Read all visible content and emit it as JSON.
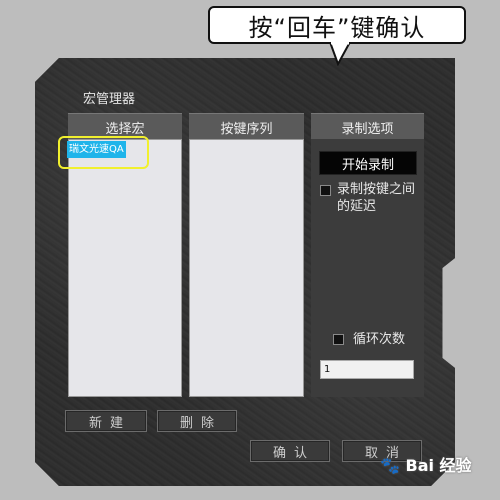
{
  "callout": {
    "text": "按“回车”键确认"
  },
  "dialog": {
    "title": "宏管理器",
    "panels": {
      "select_macro": "选择宏",
      "key_sequence": "按键序列",
      "record_options": "录制选项"
    },
    "macro_list": [
      "瑞文光速QA"
    ],
    "options": {
      "start_record": "开始录制",
      "record_delay": "录制按键之间的延迟",
      "loop_count_label": "循环次数",
      "loop_count_value": "1"
    },
    "buttons": {
      "new": "新建",
      "delete": "删除",
      "ok": "确认",
      "cancel": "取消"
    }
  },
  "watermark": {
    "text": "Bai 经验"
  },
  "colors": {
    "selection": "#1fb4ea",
    "highlight": "#f1f02e",
    "dialog_bg": "#2f2f2f"
  }
}
